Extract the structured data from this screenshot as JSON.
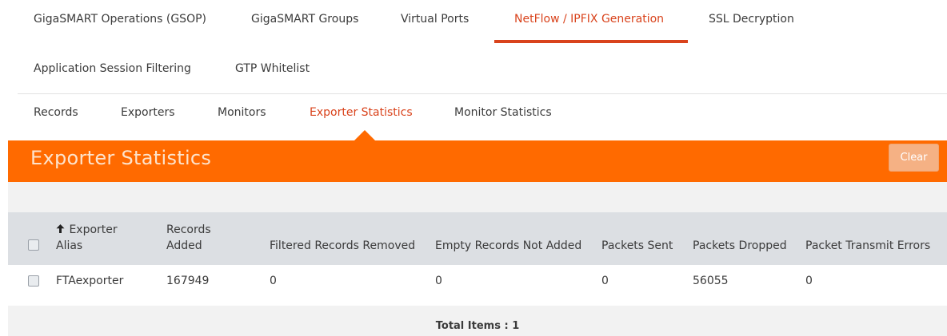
{
  "top_tabs": [
    {
      "label": "GigaSMART Operations (GSOP)",
      "active": false
    },
    {
      "label": "GigaSMART Groups",
      "active": false
    },
    {
      "label": "Virtual Ports",
      "active": false
    },
    {
      "label": "NetFlow / IPFIX Generation",
      "active": true
    },
    {
      "label": "SSL Decryption",
      "active": false
    },
    {
      "label": "Application Session Filtering",
      "active": false
    },
    {
      "label": "GTP Whitelist",
      "active": false
    }
  ],
  "sub_tabs": [
    {
      "label": "Records",
      "active": false
    },
    {
      "label": "Exporters",
      "active": false
    },
    {
      "label": "Monitors",
      "active": false
    },
    {
      "label": "Exporter Statistics",
      "active": true
    },
    {
      "label": "Monitor Statistics",
      "active": false
    }
  ],
  "header": {
    "title": "Exporter Statistics",
    "clear_label": "Clear",
    "accent_color": "#ff6a00"
  },
  "table": {
    "sort_icon": "arrow-up-icon",
    "columns": [
      {
        "line1": "Exporter",
        "line2": "Alias"
      },
      {
        "line1": "Records",
        "line2": "Added"
      },
      {
        "line1": "",
        "line2": "Filtered Records Removed"
      },
      {
        "line1": "",
        "line2": "Empty Records Not Added"
      },
      {
        "line1": "",
        "line2": "Packets Sent"
      },
      {
        "line1": "",
        "line2": "Packets Dropped"
      },
      {
        "line1": "",
        "line2": "Packet Transmit Errors"
      }
    ],
    "rows": [
      {
        "exporter_alias": "FTAexporter",
        "records_added": "167949",
        "filtered_records_removed": "0",
        "empty_records_not_added": "0",
        "packets_sent": "0",
        "packets_dropped": "56055",
        "packet_transmit_errors": "0"
      }
    ]
  },
  "footer": {
    "total_label": "Total Items : 1"
  }
}
